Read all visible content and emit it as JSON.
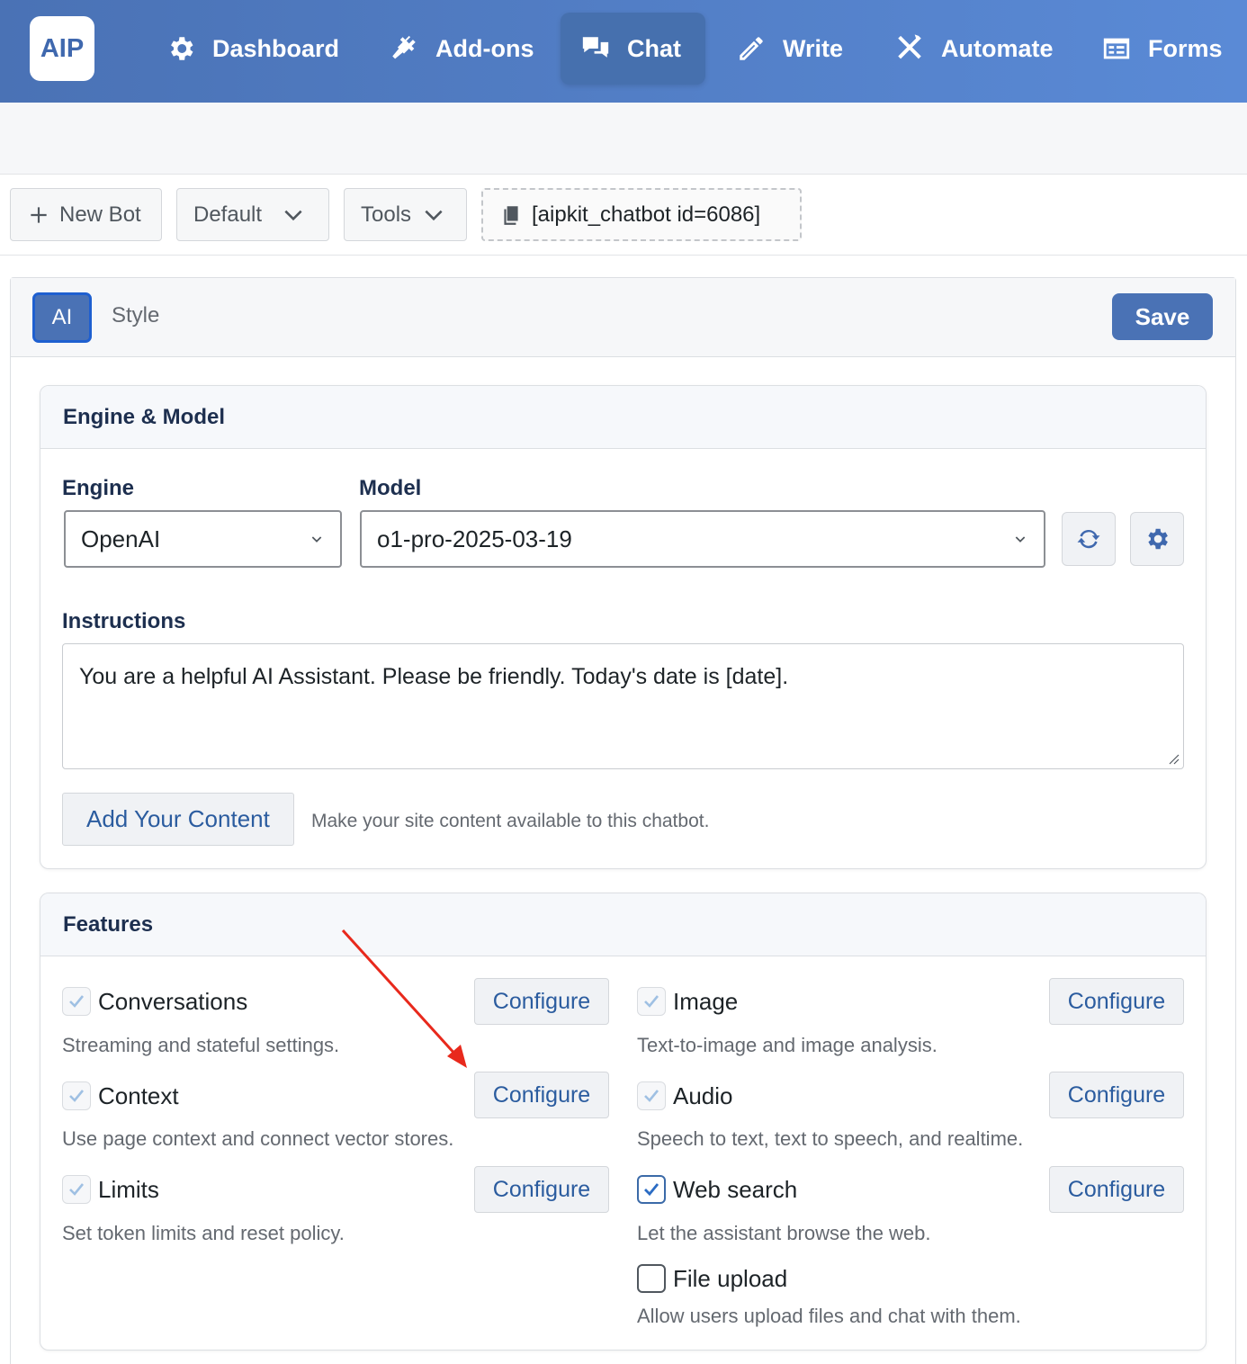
{
  "nav": {
    "logo": "AIP",
    "items": [
      {
        "label": "Dashboard",
        "icon": "gear-icon"
      },
      {
        "label": "Add-ons",
        "icon": "plug-icon"
      },
      {
        "label": "Chat",
        "icon": "chat-bubbles-icon",
        "active": true
      },
      {
        "label": "Write",
        "icon": "pencil-icon"
      },
      {
        "label": "Automate",
        "icon": "crossed-tools-icon"
      },
      {
        "label": "Forms",
        "icon": "form-icon"
      }
    ]
  },
  "toolbar": {
    "new_bot": "New Bot",
    "bot_select": "Default",
    "tools": "Tools",
    "shortcode": "[aipkit_chatbot id=6086]"
  },
  "tabs": {
    "ai": "AI",
    "style": "Style",
    "save": "Save"
  },
  "engine_model": {
    "title": "Engine & Model",
    "engine_label": "Engine",
    "engine_value": "OpenAI",
    "model_label": "Model",
    "model_value": "o1-pro-2025-03-19",
    "instructions_label": "Instructions",
    "instructions_value": "You are a helpful AI Assistant. Please be friendly. Today's date is [date].",
    "add_content": "Add Your Content",
    "add_content_hint": "Make your site content available to this chatbot."
  },
  "features": {
    "title": "Features",
    "configure_label": "Configure",
    "items": [
      {
        "label": "Conversations",
        "desc": "Streaming and stateful settings.",
        "state": "checked-disabled"
      },
      {
        "label": "Context",
        "desc": "Use page context and connect vector stores.",
        "state": "checked-disabled"
      },
      {
        "label": "Limits",
        "desc": "Set token limits and reset policy.",
        "state": "checked-disabled"
      },
      {
        "label": "Image",
        "desc": "Text-to-image and image analysis.",
        "state": "checked-disabled"
      },
      {
        "label": "Audio",
        "desc": "Speech to text, text to speech, and realtime.",
        "state": "checked-disabled"
      },
      {
        "label": "Web search",
        "desc": "Let the assistant browse the web.",
        "state": "checked"
      },
      {
        "label": "File upload",
        "desc": "Allow users upload files and chat with them.",
        "state": "unchecked"
      }
    ]
  },
  "colors": {
    "nav_start": "#4a72b5",
    "nav_end": "#5a8ad6",
    "accent": "#4a72b5",
    "link": "#2b5c9f",
    "annotation_arrow": "#e8291c"
  }
}
